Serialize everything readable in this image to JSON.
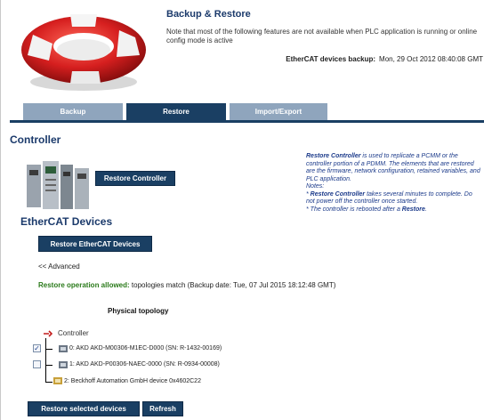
{
  "header": {
    "title": "Backup & Restore",
    "note": "Note that most of the following features are not available when PLC application is running or online config mode is active",
    "backup_label": "EtherCAT devices backup:",
    "backup_date": "Mon, 29 Oct 2012 08:40:08 GMT"
  },
  "tabs": [
    {
      "label": "Backup"
    },
    {
      "label": "Restore"
    },
    {
      "label": "Import/Export"
    }
  ],
  "controller": {
    "heading": "Controller",
    "restore_button": "Restore Controller"
  },
  "info": {
    "p1_bold": "Restore Controller",
    "p1_rest": " is used to replicate a PCMM or the controller portion of a PDMM. The elements that are restored are the firmware, network configuration, retained variables, and PLC application.",
    "notes_label": "Notes:",
    "n1_bold": "Restore Controller",
    "n1_rest": " takes several minutes to complete. Do not power off the controller once started.",
    "n2_pre": "* The controller is rebooted after a ",
    "n2_bold": "Restore",
    "n2_post": "."
  },
  "ethercat": {
    "heading": "EtherCAT Devices",
    "restore_button": "Restore EtherCAT Devices",
    "advanced_link": "<< Advanced",
    "allowed_label": "Restore operation allowed:",
    "allowed_text": " topologies match (Backup date: Tue, 07 Jul 2015 18:12:48 GMT)"
  },
  "topology": {
    "title": "Physical topology",
    "root_label": "Controller",
    "devices": [
      {
        "label": "0: AKD AKD-M00306-M1EC-D000 (SN: R-1432-00169)",
        "checked": true
      },
      {
        "label": "1: AKD AKD-P00306-NAEC-0000 (SN: R-0934-00008)",
        "checked": false
      },
      {
        "label": "2: Beckhoff Automation GmbH device 0x4602C22",
        "checked": null
      }
    ]
  },
  "footer": {
    "restore_selected": "Restore selected devices",
    "refresh": "Refresh"
  },
  "colors": {
    "accent": "#1a3f63",
    "inactive_tab": "#8fa5bd",
    "success": "#2a7a1a",
    "info_text": "#1b3a8a"
  }
}
